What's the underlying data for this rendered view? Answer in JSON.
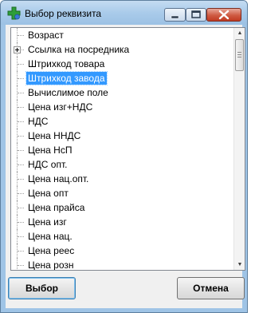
{
  "window": {
    "title": "Выбор реквизита",
    "icon": "green-cross-app-icon",
    "controls": [
      "minimize-icon",
      "maximize-icon",
      "close-icon"
    ]
  },
  "list": {
    "items": [
      {
        "label": "Возраст",
        "expandable": false,
        "selected": false
      },
      {
        "label": "Ссылка на посредника",
        "expandable": true,
        "selected": false
      },
      {
        "label": "Штрихкод товара",
        "expandable": false,
        "selected": false
      },
      {
        "label": "Штрихкод завода",
        "expandable": false,
        "selected": true
      },
      {
        "label": "Вычислимое поле",
        "expandable": false,
        "selected": false
      },
      {
        "label": "Цена изг+НДС",
        "expandable": false,
        "selected": false
      },
      {
        "label": "НДС",
        "expandable": false,
        "selected": false
      },
      {
        "label": "Цена ННДС",
        "expandable": false,
        "selected": false
      },
      {
        "label": "Цена НсП",
        "expandable": false,
        "selected": false
      },
      {
        "label": "НДС опт.",
        "expandable": false,
        "selected": false
      },
      {
        "label": "Цена нац.опт.",
        "expandable": false,
        "selected": false
      },
      {
        "label": "Цена опт",
        "expandable": false,
        "selected": false
      },
      {
        "label": "Цена прайса",
        "expandable": false,
        "selected": false
      },
      {
        "label": "Цена изг",
        "expandable": false,
        "selected": false
      },
      {
        "label": "Цена нац.",
        "expandable": false,
        "selected": false
      },
      {
        "label": "Цена реес",
        "expandable": false,
        "selected": false
      },
      {
        "label": "Цена розн",
        "expandable": false,
        "selected": false
      }
    ]
  },
  "buttons": {
    "select_label": "Выбор",
    "cancel_label": "Отмена"
  },
  "colors": {
    "selection": "#3399ff",
    "title_bar": "#a9cbea",
    "close_button": "#cf5a42"
  }
}
